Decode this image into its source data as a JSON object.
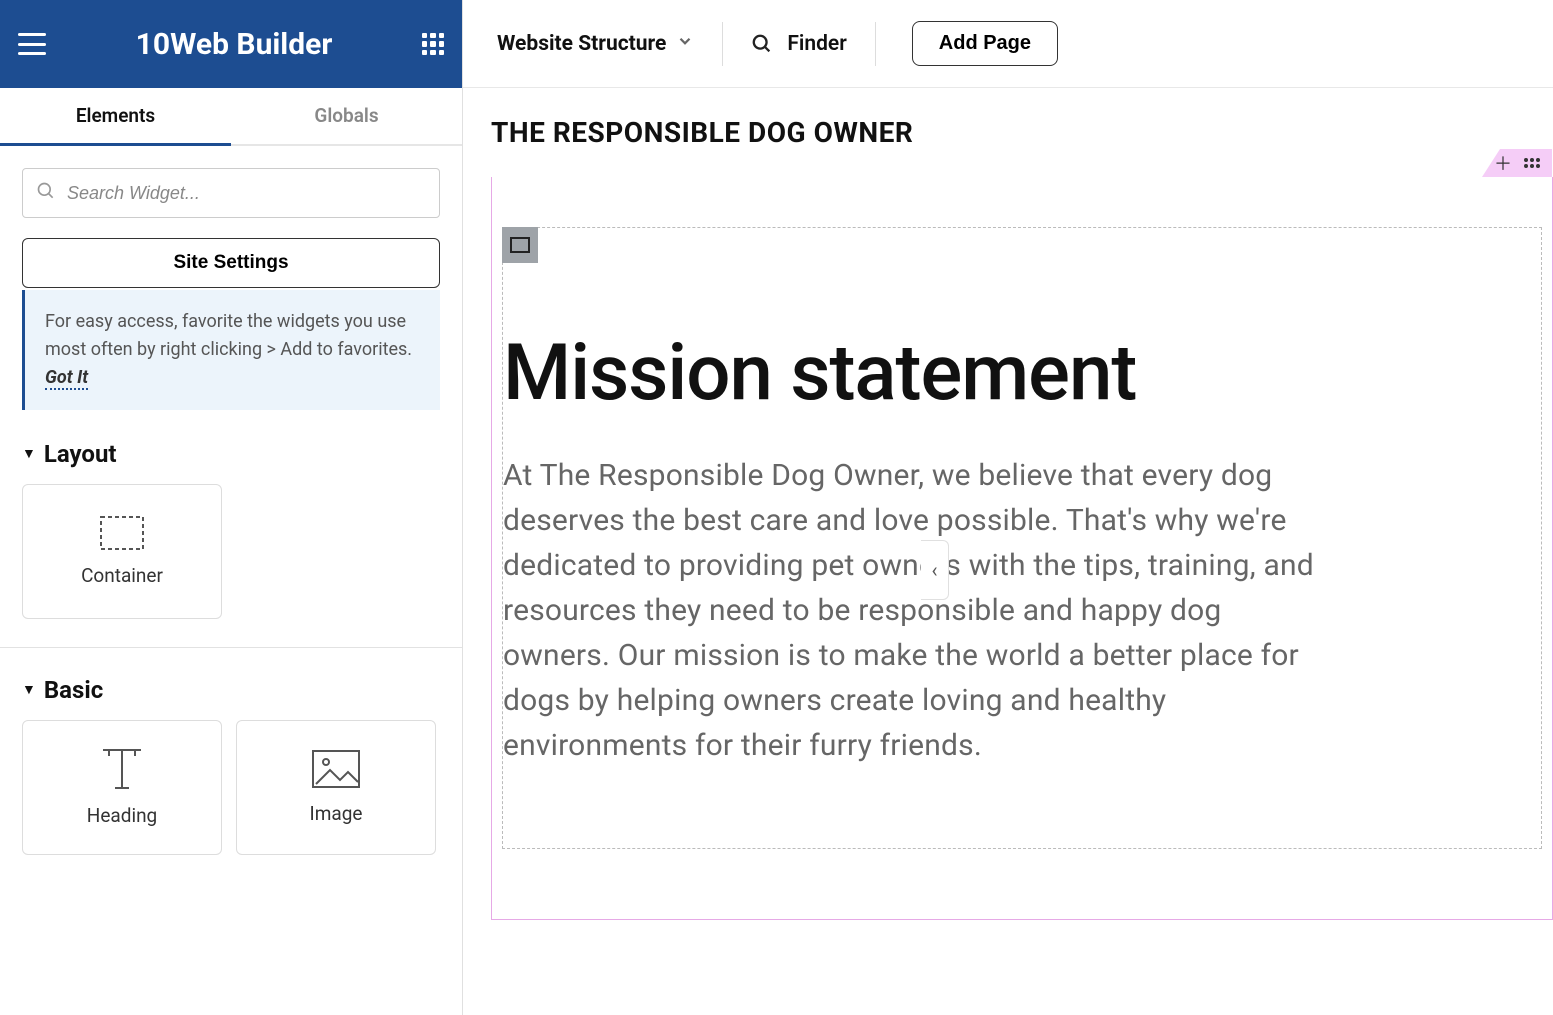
{
  "brand": "10Web Builder",
  "tabs": {
    "elements": "Elements",
    "globals": "Globals"
  },
  "search": {
    "placeholder": "Search Widget..."
  },
  "site_settings": "Site Settings",
  "tip": {
    "text": "For easy access, favorite the widgets you use most often by right clicking > Add to favorites.",
    "gotit": "Got It"
  },
  "categories": {
    "layout": {
      "title": "Layout",
      "widgets": [
        {
          "name": "Container"
        }
      ]
    },
    "basic": {
      "title": "Basic",
      "widgets": [
        {
          "name": "Heading"
        },
        {
          "name": "Image"
        }
      ]
    }
  },
  "maintop": {
    "website_structure": "Website Structure",
    "finder": "Finder",
    "add_page": "Add Page"
  },
  "canvas": {
    "site_title": "THE RESPONSIBLE DOG OWNER",
    "heading": "Mission statement",
    "body": "At The Responsible Dog Owner, we believe that every dog deserves the best care and love possible. That's why we're dedicated to providing pet owners with the tips, training, and resources they need to be responsible and happy dog owners. Our mission is to make the world a better place for dogs by helping owners create loving and healthy environments for their furry friends."
  }
}
